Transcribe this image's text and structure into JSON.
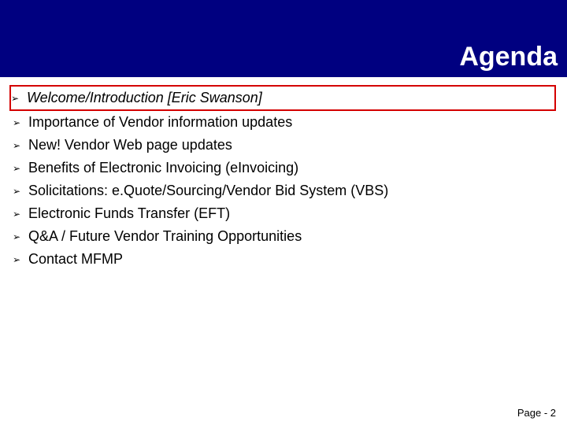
{
  "header": {
    "title": "Agenda"
  },
  "agenda": {
    "bullet": "➢",
    "items": [
      {
        "text": "Welcome/Introduction [Eric Swanson]",
        "highlighted": true
      },
      {
        "text": "Importance of Vendor information updates",
        "highlighted": false
      },
      {
        "text": "New! Vendor Web page updates",
        "highlighted": false
      },
      {
        "text": "Benefits of Electronic Invoicing (eInvoicing)",
        "highlighted": false
      },
      {
        "text": "Solicitations: e.Quote/Sourcing/Vendor Bid System (VBS)",
        "highlighted": false
      },
      {
        "text": "Electronic Funds Transfer (EFT)",
        "highlighted": false
      },
      {
        "text": "Q&A / Future Vendor Training Opportunities",
        "highlighted": false
      },
      {
        "text": "Contact MFMP",
        "highlighted": false
      }
    ]
  },
  "footer": {
    "page_label": "Page - 2"
  }
}
